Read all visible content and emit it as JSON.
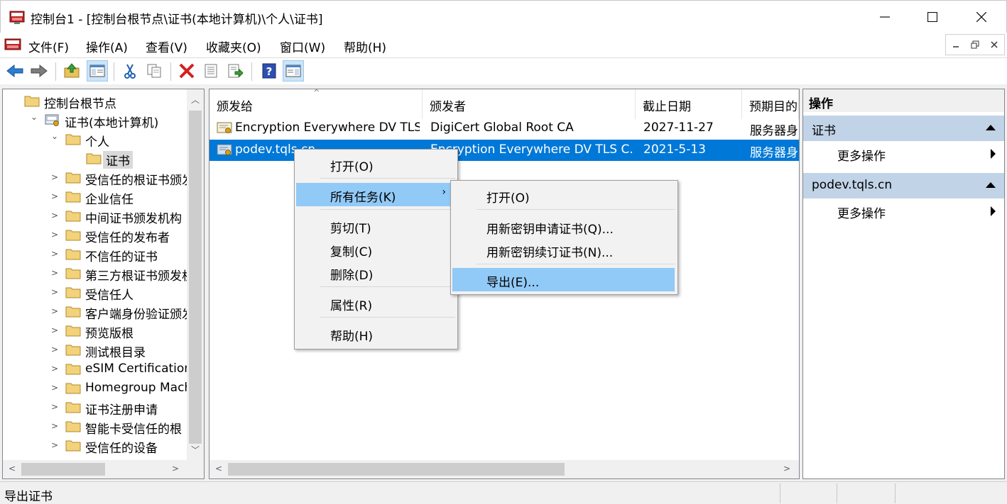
{
  "window": {
    "title": "控制台1 - [控制台根节点\\证书(本地计算机)\\个人\\证书]"
  },
  "menubar": {
    "items": [
      "文件(F)",
      "操作(A)",
      "查看(V)",
      "收藏夹(O)",
      "窗口(W)",
      "帮助(H)"
    ]
  },
  "tree": {
    "root": "控制台根节点",
    "store": "证书(本地计算机)",
    "personal": "个人",
    "certs": "证书",
    "children": [
      "受信任的根证书颁发",
      "企业信任",
      "中间证书颁发机构",
      "受信任的发布者",
      "不信任的证书",
      "第三方根证书颁发机",
      "受信任人",
      "客户端身份验证颁发",
      "预览版根",
      "测试根目录",
      "eSIM Certification A",
      "Homegroup Machin",
      "证书注册申请",
      "智能卡受信任的根",
      "受信任的设备"
    ]
  },
  "list": {
    "columns": [
      "颁发给",
      "颁发者",
      "截止日期",
      "预期目的"
    ],
    "rows": [
      {
        "issued_to": "Encryption Everywhere DV TLS...",
        "issuer": "DigiCert Global Root CA",
        "expires": "2027-11-27",
        "purpose": "服务器身"
      },
      {
        "issued_to": "podev.tqls.cn",
        "issuer": "Encryption Everywhere DV TLS C...",
        "expires": "2021-5-13",
        "purpose": "服务器身"
      }
    ]
  },
  "context_menu": {
    "items": [
      "打开(O)",
      "所有任务(K)",
      "剪切(T)",
      "复制(C)",
      "删除(D)",
      "属性(R)",
      "帮助(H)"
    ]
  },
  "submenu": {
    "items": [
      "打开(O)",
      "用新密钥申请证书(Q)...",
      "用新密钥续订证书(N)...",
      "导出(E)..."
    ]
  },
  "actions": {
    "title": "操作",
    "section1": "证书",
    "section1_item": "更多操作",
    "section2": "podev.tqls.cn",
    "section2_item": "更多操作"
  },
  "status": {
    "text": "导出证书"
  },
  "colors": {
    "selection": "#0078d7",
    "menu_hot": "#91c9f7",
    "action_header": "#c1d3e6",
    "delete_red": "#d61f1f"
  }
}
